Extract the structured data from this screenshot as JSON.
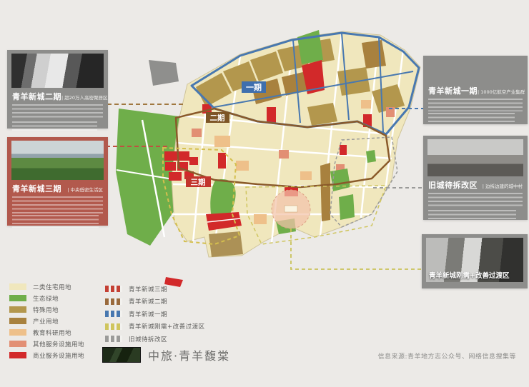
{
  "map": {
    "labels": {
      "phase1": "一期",
      "phase2": "二期",
      "phase3": "三期"
    },
    "phase_colors": {
      "phase1": "#3f6fae",
      "phase2": "#7d5526",
      "phase3": "#c2342c"
    }
  },
  "cards": {
    "phase2": {
      "title": "青羊新城二期",
      "tag": "| 超20万人高密聚居区"
    },
    "phase3": {
      "title": "青羊新城三期",
      "tag": "| 中央低密生活区"
    },
    "phase1": {
      "title": "青羊新城一期",
      "tag": "| 1000亿航空产业集群"
    },
    "old_town": {
      "title": "旧城待拆改区",
      "tag": "| 边拆边建的城中村"
    },
    "transition": {
      "title": "青羊新城刚需+改善过渡区"
    }
  },
  "legend": {
    "land_use": [
      {
        "label": "二类住宅用地",
        "color": "#f0e7bd"
      },
      {
        "label": "生态绿地",
        "color": "#6fae4a"
      },
      {
        "label": "特殊用地",
        "color": "#b3974d"
      },
      {
        "label": "产业用地",
        "color": "#a8813e"
      },
      {
        "label": "教育科研用地",
        "color": "#eec08a"
      },
      {
        "label": "其他服务设施用地",
        "color": "#e28f74"
      },
      {
        "label": "商业服务设施用地",
        "color": "#d2292a"
      }
    ],
    "zones": [
      {
        "label": "青羊新城三期",
        "color": "#c44034"
      },
      {
        "label": "青羊新城二期",
        "color": "#9a6a3c"
      },
      {
        "label": "青羊新城一期",
        "color": "#4878b0"
      },
      {
        "label": "青羊新城刚需+改善过渡区",
        "color": "#cfc55e"
      },
      {
        "label": "旧城待拆改区",
        "color": "#9b9b99"
      }
    ]
  },
  "logo": {
    "text": "中旅·青羊馥棠"
  },
  "footer": {
    "source": "信息来源:青羊地方志公众号、网络信息搜集等"
  }
}
